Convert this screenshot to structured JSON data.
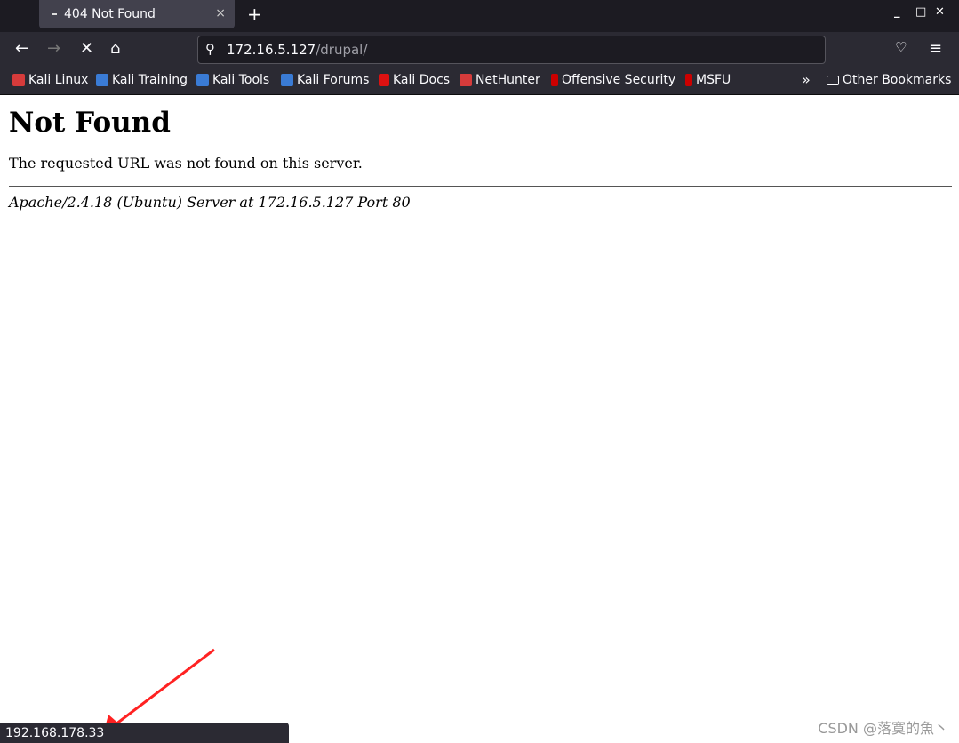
{
  "tab": {
    "title": "404 Not Found",
    "close": "×",
    "new": "+"
  },
  "window": {
    "minimize": "_",
    "maximize": "□",
    "close": "✕"
  },
  "nav": {
    "back": "←",
    "forward": "→",
    "stop": "✕",
    "home": "⌂",
    "pocket": "♡",
    "menu": "≡",
    "search_icon": "⚲",
    "url_host": "172.16.5.127",
    "url_path": "/drupal/"
  },
  "bookmarks": [
    {
      "label": "Kali Linux",
      "color": "#d63b3b"
    },
    {
      "label": "Kali Training",
      "color": "#3a7bd5"
    },
    {
      "label": "Kali Tools",
      "color": "#3a7bd5"
    },
    {
      "label": "Kali Forums",
      "color": "#3a7bd5"
    },
    {
      "label": "Kali Docs",
      "color": "#d11"
    },
    {
      "label": "NetHunter",
      "color": "#d63b3b"
    },
    {
      "label": "Offensive Security",
      "color": "#c00"
    },
    {
      "label": "MSFU",
      "color": "#c00"
    }
  ],
  "overflow": "»",
  "other_bookmarks": "Other Bookmarks",
  "page": {
    "heading": "Not Found",
    "message": "The requested URL was not found on this server.",
    "address": "Apache/2.4.18 (Ubuntu) Server at 172.16.5.127 Port 80"
  },
  "status": "192.168.178.33",
  "watermark": "CSDN @落寞的魚丶"
}
